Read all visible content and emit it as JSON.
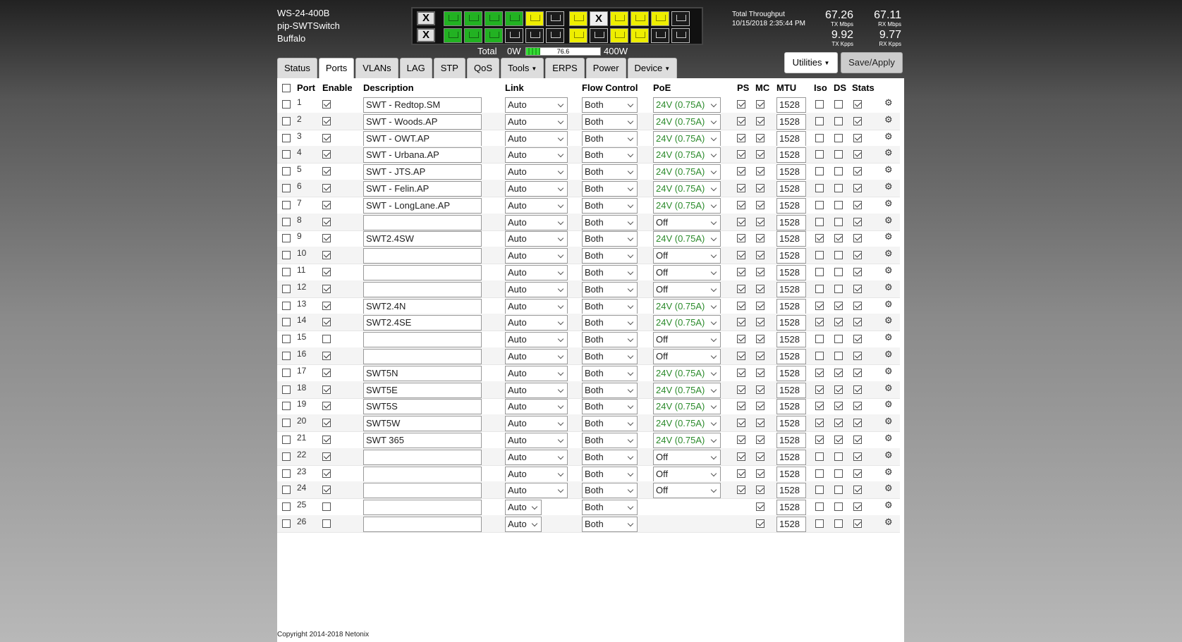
{
  "device": {
    "model": "WS-24-400B",
    "name": "pip-SWTSwitch",
    "location": "Buffalo"
  },
  "port_panel": {
    "top_left_sfp": "X",
    "bottom_left_sfp": "X",
    "top_ports": [
      "g",
      "g",
      "g",
      "g",
      "y",
      "d",
      "y",
      "x",
      "y",
      "y",
      "y",
      "d"
    ],
    "bottom_ports": [
      "g",
      "g",
      "g",
      "d",
      "d",
      "d",
      "y",
      "d",
      "y",
      "y",
      "d",
      "d"
    ],
    "x_label": "X"
  },
  "power": {
    "label": "Total",
    "min": "0W",
    "value": "76.6",
    "max": "400W",
    "fraction": 0.19
  },
  "throughput": {
    "title": "Total Throughput",
    "timestamp": "10/15/2018 2:35:44 PM",
    "tx_mbps": "67.26",
    "tx_mbps_unit": "TX Mbps",
    "rx_mbps": "67.11",
    "rx_mbps_unit": "RX Mbps",
    "tx_kpps": "9.92",
    "tx_kpps_unit": "TX Kpps",
    "rx_kpps": "9.77",
    "rx_kpps_unit": "RX Kpps"
  },
  "buttons": {
    "utilities": "Utilities",
    "save": "Save/Apply"
  },
  "tabs": [
    {
      "label": "Status",
      "dropdown": false
    },
    {
      "label": "Ports",
      "dropdown": false,
      "active": true
    },
    {
      "label": "VLANs",
      "dropdown": false
    },
    {
      "label": "LAG",
      "dropdown": false
    },
    {
      "label": "STP",
      "dropdown": false
    },
    {
      "label": "QoS",
      "dropdown": false
    },
    {
      "label": "Tools",
      "dropdown": true
    },
    {
      "label": "ERPS",
      "dropdown": false
    },
    {
      "label": "Power",
      "dropdown": false
    },
    {
      "label": "Device",
      "dropdown": true
    }
  ],
  "table": {
    "headers": {
      "port": "Port",
      "enable": "Enable",
      "description": "Description",
      "link": "Link",
      "flow": "Flow Control",
      "poe": "PoE",
      "ps": "PS",
      "mc": "MC",
      "mtu": "MTU",
      "iso": "Iso",
      "ds": "DS",
      "stats": "Stats"
    },
    "rows": [
      {
        "port": "1",
        "en": true,
        "desc": "SWT - Redtop.SM",
        "link": "Auto",
        "fc": "Both",
        "poe": "24V (0.75A)",
        "ps": true,
        "mc": true,
        "mtu": "1528",
        "iso": false,
        "ds": false,
        "st": true
      },
      {
        "port": "2",
        "en": true,
        "desc": "SWT - Woods.AP",
        "link": "Auto",
        "fc": "Both",
        "poe": "24V (0.75A)",
        "ps": true,
        "mc": true,
        "mtu": "1528",
        "iso": false,
        "ds": false,
        "st": true
      },
      {
        "port": "3",
        "en": true,
        "desc": "SWT - OWT.AP",
        "link": "Auto",
        "fc": "Both",
        "poe": "24V (0.75A)",
        "ps": true,
        "mc": true,
        "mtu": "1528",
        "iso": false,
        "ds": false,
        "st": true
      },
      {
        "port": "4",
        "en": true,
        "desc": "SWT - Urbana.AP",
        "link": "Auto",
        "fc": "Both",
        "poe": "24V (0.75A)",
        "ps": true,
        "mc": true,
        "mtu": "1528",
        "iso": false,
        "ds": false,
        "st": true
      },
      {
        "port": "5",
        "en": true,
        "desc": "SWT - JTS.AP",
        "link": "Auto",
        "fc": "Both",
        "poe": "24V (0.75A)",
        "ps": true,
        "mc": true,
        "mtu": "1528",
        "iso": false,
        "ds": false,
        "st": true
      },
      {
        "port": "6",
        "en": true,
        "desc": "SWT - Felin.AP",
        "link": "Auto",
        "fc": "Both",
        "poe": "24V (0.75A)",
        "ps": true,
        "mc": true,
        "mtu": "1528",
        "iso": false,
        "ds": false,
        "st": true
      },
      {
        "port": "7",
        "en": true,
        "desc": "SWT - LongLane.AP",
        "link": "Auto",
        "fc": "Both",
        "poe": "24V (0.75A)",
        "ps": true,
        "mc": true,
        "mtu": "1528",
        "iso": false,
        "ds": false,
        "st": true
      },
      {
        "port": "8",
        "en": true,
        "desc": "",
        "link": "Auto",
        "fc": "Both",
        "poe": "Off",
        "ps": true,
        "mc": true,
        "mtu": "1528",
        "iso": false,
        "ds": false,
        "st": true
      },
      {
        "port": "9",
        "en": true,
        "desc": "SWT2.4SW",
        "link": "Auto",
        "fc": "Both",
        "poe": "24V (0.75A)",
        "ps": true,
        "mc": true,
        "mtu": "1528",
        "iso": true,
        "ds": true,
        "st": true
      },
      {
        "port": "10",
        "en": true,
        "desc": "",
        "link": "Auto",
        "fc": "Both",
        "poe": "Off",
        "ps": true,
        "mc": true,
        "mtu": "1528",
        "iso": false,
        "ds": false,
        "st": true
      },
      {
        "port": "11",
        "en": true,
        "desc": "",
        "link": "Auto",
        "fc": "Both",
        "poe": "Off",
        "ps": true,
        "mc": true,
        "mtu": "1528",
        "iso": false,
        "ds": false,
        "st": true
      },
      {
        "port": "12",
        "en": true,
        "desc": "",
        "link": "Auto",
        "fc": "Both",
        "poe": "Off",
        "ps": true,
        "mc": true,
        "mtu": "1528",
        "iso": false,
        "ds": false,
        "st": true
      },
      {
        "port": "13",
        "en": true,
        "desc": "SWT2.4N",
        "link": "Auto",
        "fc": "Both",
        "poe": "24V (0.75A)",
        "ps": true,
        "mc": true,
        "mtu": "1528",
        "iso": true,
        "ds": true,
        "st": true
      },
      {
        "port": "14",
        "en": true,
        "desc": "SWT2.4SE",
        "link": "Auto",
        "fc": "Both",
        "poe": "24V (0.75A)",
        "ps": true,
        "mc": true,
        "mtu": "1528",
        "iso": true,
        "ds": true,
        "st": true
      },
      {
        "port": "15",
        "en": false,
        "desc": "",
        "link": "Auto",
        "fc": "Both",
        "poe": "Off",
        "ps": true,
        "mc": true,
        "mtu": "1528",
        "iso": false,
        "ds": false,
        "st": true
      },
      {
        "port": "16",
        "en": true,
        "desc": "",
        "link": "Auto",
        "fc": "Both",
        "poe": "Off",
        "ps": true,
        "mc": true,
        "mtu": "1528",
        "iso": false,
        "ds": false,
        "st": true
      },
      {
        "port": "17",
        "en": true,
        "desc": "SWT5N",
        "link": "Auto",
        "fc": "Both",
        "poe": "24V (0.75A)",
        "ps": true,
        "mc": true,
        "mtu": "1528",
        "iso": true,
        "ds": true,
        "st": true
      },
      {
        "port": "18",
        "en": true,
        "desc": "SWT5E",
        "link": "Auto",
        "fc": "Both",
        "poe": "24V (0.75A)",
        "ps": true,
        "mc": true,
        "mtu": "1528",
        "iso": true,
        "ds": true,
        "st": true
      },
      {
        "port": "19",
        "en": true,
        "desc": "SWT5S",
        "link": "Auto",
        "fc": "Both",
        "poe": "24V (0.75A)",
        "ps": true,
        "mc": true,
        "mtu": "1528",
        "iso": true,
        "ds": true,
        "st": true
      },
      {
        "port": "20",
        "en": true,
        "desc": "SWT5W",
        "link": "Auto",
        "fc": "Both",
        "poe": "24V (0.75A)",
        "ps": true,
        "mc": true,
        "mtu": "1528",
        "iso": true,
        "ds": true,
        "st": true
      },
      {
        "port": "21",
        "en": true,
        "desc": "SWT 365",
        "link": "Auto",
        "fc": "Both",
        "poe": "24V (0.75A)",
        "ps": true,
        "mc": true,
        "mtu": "1528",
        "iso": true,
        "ds": true,
        "st": true
      },
      {
        "port": "22",
        "en": true,
        "desc": "",
        "link": "Auto",
        "fc": "Both",
        "poe": "Off",
        "ps": true,
        "mc": true,
        "mtu": "1528",
        "iso": false,
        "ds": false,
        "st": true
      },
      {
        "port": "23",
        "en": true,
        "desc": "",
        "link": "Auto",
        "fc": "Both",
        "poe": "Off",
        "ps": true,
        "mc": true,
        "mtu": "1528",
        "iso": false,
        "ds": false,
        "st": true
      },
      {
        "port": "24",
        "en": true,
        "desc": "",
        "link": "Auto",
        "fc": "Both",
        "poe": "Off",
        "ps": true,
        "mc": true,
        "mtu": "1528",
        "iso": false,
        "ds": false,
        "st": true
      },
      {
        "port": "25",
        "en": false,
        "desc": "",
        "link": "Auto",
        "fc": "Both",
        "poe": null,
        "ps": null,
        "mc": true,
        "mtu": "1528",
        "iso": false,
        "ds": false,
        "st": true
      },
      {
        "port": "26",
        "en": false,
        "desc": "",
        "link": "Auto",
        "fc": "Both",
        "poe": null,
        "ps": null,
        "mc": true,
        "mtu": "1528",
        "iso": false,
        "ds": false,
        "st": true
      }
    ]
  },
  "icons": {
    "settings": "gear-icon"
  },
  "copyright": "Copyright 2014-2018 Netonix"
}
